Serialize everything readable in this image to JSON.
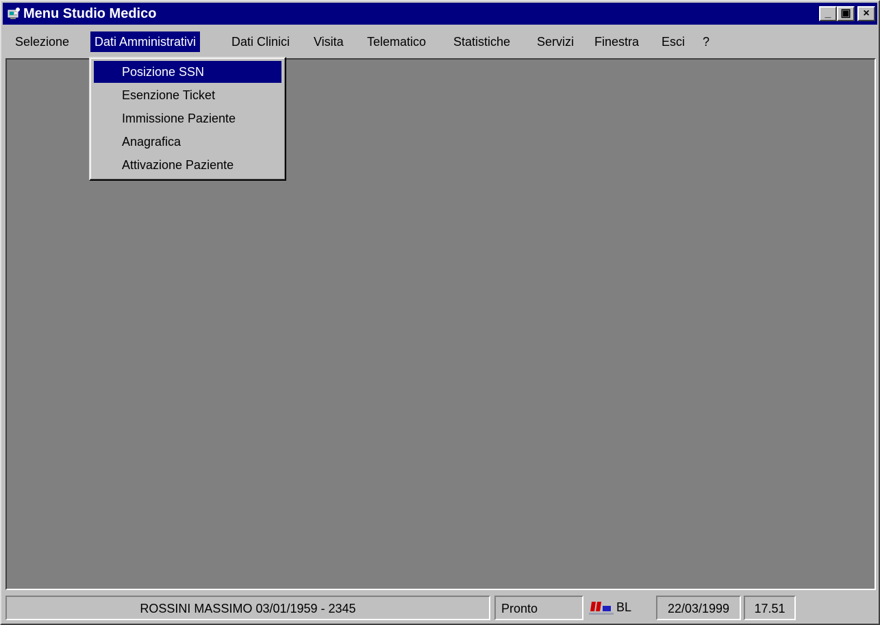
{
  "window": {
    "title": "Menu Studio Medico",
    "controls": {
      "minimize": "_",
      "maximize": "▣",
      "close": "×"
    }
  },
  "menubar": {
    "items": [
      {
        "label": "Selezione"
      },
      {
        "label": "Dati Amministrativi",
        "active": true
      },
      {
        "label": "Dati Clinici"
      },
      {
        "label": "Visita"
      },
      {
        "label": "Telematico"
      },
      {
        "label": "Statistiche"
      },
      {
        "label": "Servizi"
      },
      {
        "label": "Finestra"
      },
      {
        "label": "Esci"
      },
      {
        "label": "?"
      }
    ]
  },
  "dropdown": {
    "items": [
      {
        "label": "Posizione SSN",
        "selected": true
      },
      {
        "label": "Esenzione Ticket"
      },
      {
        "label": "Immissione Paziente"
      },
      {
        "label": "Anagrafica"
      },
      {
        "label": "Attivazione Paziente"
      }
    ]
  },
  "statusbar": {
    "patient": "ROSSINI MASSIMO 03/01/1959 - 2345",
    "status": "Pronto",
    "code": "BL",
    "date": "22/03/1999",
    "time": "17.51"
  },
  "colors": {
    "title_bar": "#000080",
    "selection": "#000080",
    "face": "#c0c0c0",
    "workspace": "#808080"
  }
}
